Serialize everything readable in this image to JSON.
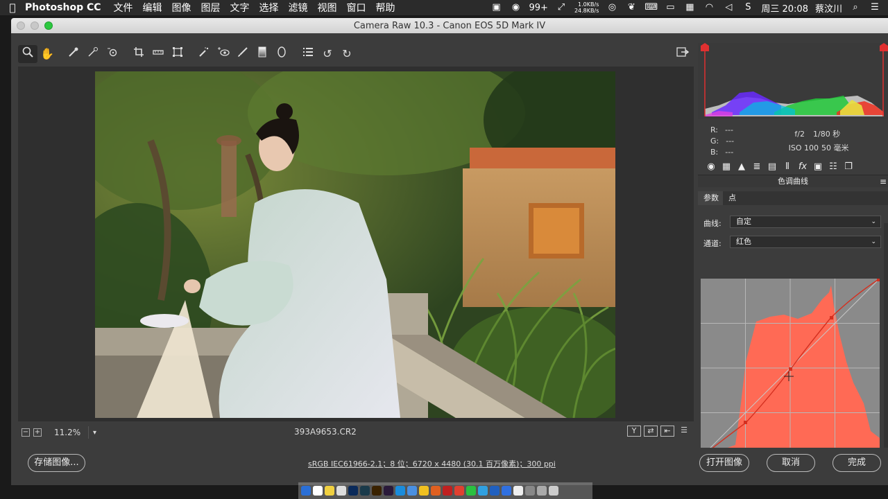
{
  "menubar": {
    "app_name": "Photoshop CC",
    "menus": [
      "文件",
      "编辑",
      "图像",
      "图层",
      "文字",
      "选择",
      "滤镜",
      "视图",
      "窗口",
      "帮助"
    ],
    "notifications": "99+",
    "net_up": "1.0KB/s",
    "net_down": "24.8KB/s",
    "clock": "周三 20:08",
    "user": "蔡汶川"
  },
  "window": {
    "title": "Camera Raw 10.3 -  Canon EOS 5D Mark IV"
  },
  "toolbar": {
    "tools": [
      "zoom-tool",
      "hand-tool",
      "white-balance-tool",
      "color-sampler-tool",
      "targeted-adjustment-tool",
      "crop-tool",
      "straighten-tool",
      "transform-tool",
      "spot-removal-tool",
      "red-eye-tool",
      "adjustment-brush-tool",
      "graduated-filter-tool",
      "radial-filter-tool",
      "preferences-tool",
      "rotate-left-tool",
      "rotate-right-tool"
    ]
  },
  "canvas_footer": {
    "zoom": "11.2%",
    "filename": "393A9653.CR2"
  },
  "info": {
    "r_label": "R:",
    "g_label": "G:",
    "b_label": "B:",
    "r_value": "---",
    "g_value": "---",
    "b_value": "---",
    "aperture": "f/2",
    "shutter": "1/80 秒",
    "iso": "ISO 100",
    "focal": "50 毫米"
  },
  "panel": {
    "title": "色调曲线",
    "tabs": [
      "参数",
      "点"
    ],
    "curve_label": "曲线:",
    "curve_value": "自定",
    "channel_label": "通道:",
    "channel_value": "红色"
  },
  "bottom": {
    "save_label": "存储图像...",
    "meta": "sRGB IEC61966-2.1；8 位；6720 x 4480 (30.1 百万像素)；300 ppi",
    "open_label": "打开图像",
    "cancel_label": "取消",
    "done_label": "完成"
  },
  "colors": {
    "curve_red": "#ff6a55",
    "curve_bg": "#8a8a8a"
  }
}
